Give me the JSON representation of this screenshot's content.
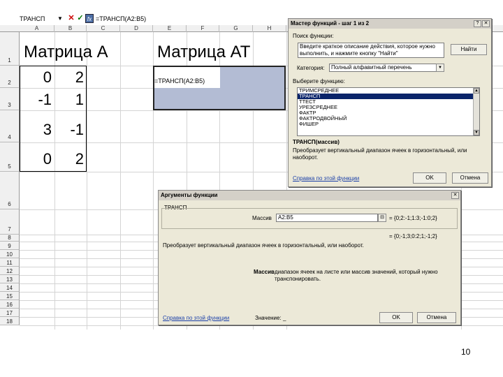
{
  "formula_bar": {
    "name_box": "ТРАНСП",
    "formula": "=ТРАНСП(A2:B5)"
  },
  "columns": [
    "A",
    "B",
    "C",
    "D",
    "E",
    "F",
    "G",
    "H"
  ],
  "rows": [
    "1",
    "2",
    "3",
    "4",
    "5",
    "6",
    "7",
    "8",
    "9",
    "10",
    "11",
    "12",
    "13",
    "14",
    "15",
    "16",
    "17",
    "18"
  ],
  "matrix_a": {
    "title": "Матрица А",
    "values": [
      [
        "0",
        "2"
      ],
      [
        "-1",
        "1"
      ],
      [
        "3",
        "-1"
      ],
      [
        "0",
        "2"
      ]
    ]
  },
  "matrix_at": {
    "title": "Матрица АТ",
    "cell_formula": "=ТРАНСП(A2:B5)"
  },
  "wizard": {
    "title": "Мастер функций - шаг 1 из 2",
    "search_label": "Поиск функции:",
    "search_text_line1": "Введите краткое описание действия, которое нужно",
    "search_text_line2": "выполнить, и нажмите кнопку \"Найти\"",
    "find_button": "Найти",
    "category_label": "Категория:",
    "category_value": "Полный алфавитный перечень",
    "select_label": "Выберите функцию:",
    "functions": [
      "ТРИМСРЕДНЕЕ",
      "ТРАНСП",
      "ТТЕСТ",
      "УРЕЗСРЕДНЕЕ",
      "ФАКТР",
      "ФАКТРОДВОЙНЫЙ",
      "ФИШЕР"
    ],
    "selected_index": 1,
    "signature": "ТРАНСП(массив)",
    "description_line1": "Преобразует вертикальный диапазон ячеек в горизонтальный, или",
    "description_line2": "наоборот.",
    "help_link": "Справка по этой функции",
    "ok_button": "OK",
    "cancel_button": "Отмена"
  },
  "args": {
    "title": "Аргументы функции",
    "group_label": "ТРАНСП",
    "array_label": "Массив",
    "array_value": "A2:B5",
    "array_result": "= {0;2:-1;1:3;-1:0;2}",
    "result_preview": "= {0;-1;3;0:2;1;-1;2}",
    "description": "Преобразует вертикальный диапазон ячеек в горизонтальный, или наоборот.",
    "param_name": "Массив",
    "param_desc_line1": "диапазон ячеек на листе или массив значений, который нужно",
    "param_desc_line2": "транспонировать.",
    "help_link": "Справка по этой функции",
    "value_label": "Значение:",
    "value_text": "_",
    "ok_button": "OK",
    "cancel_button": "Отмена"
  },
  "page_number": "10"
}
